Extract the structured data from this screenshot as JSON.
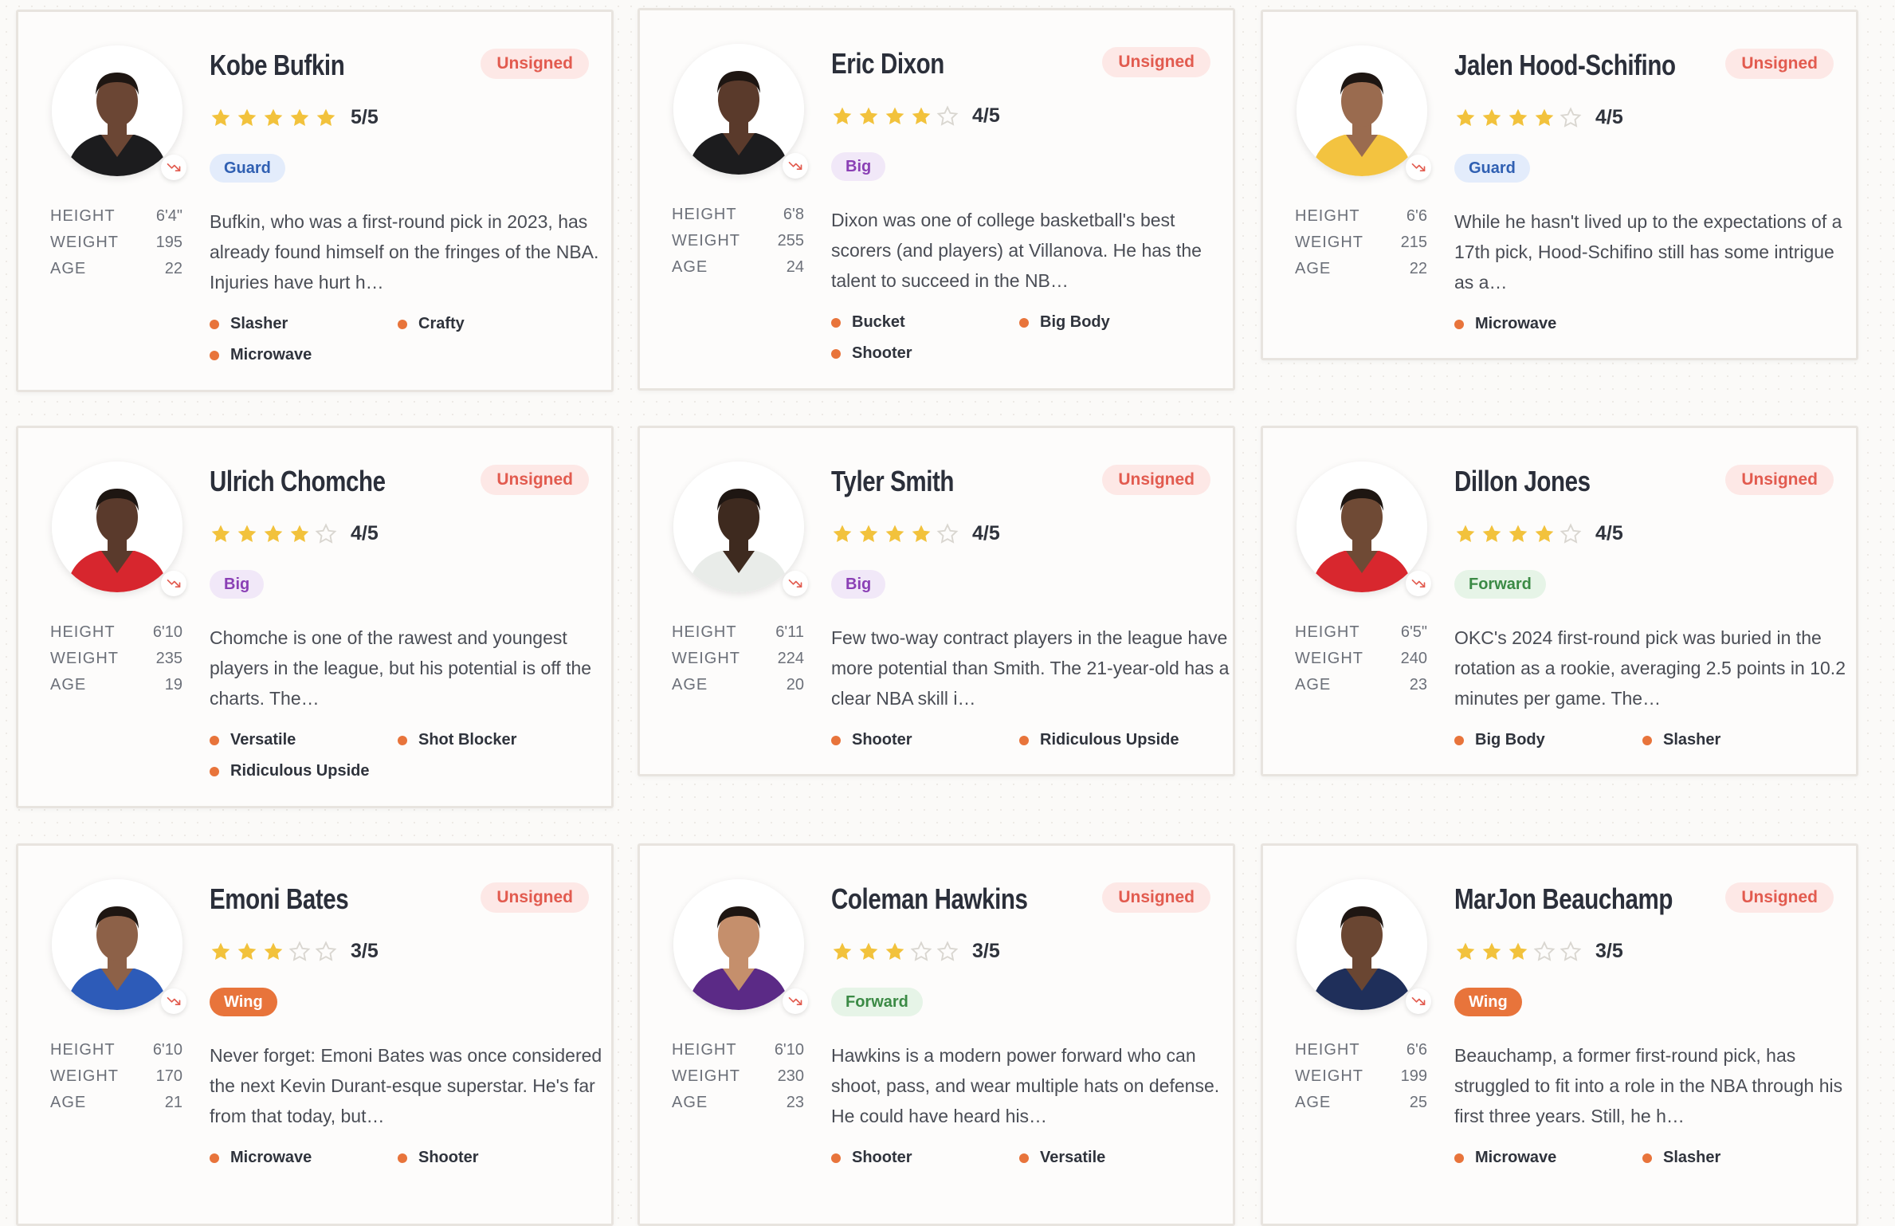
{
  "colors": {
    "star_filled": "#f2c23c",
    "star_empty": "#d9d6d0",
    "unsigned_bg": "#fde8e6",
    "unsigned_text": "#e25b4f",
    "trait_dot": "#e8743b",
    "trend_arrow": "#e25b4f"
  },
  "stat_labels": {
    "height": "HEIGHT",
    "weight": "WEIGHT",
    "age": "AGE"
  },
  "players": [
    {
      "name": "Kobe Bufkin",
      "status": "Unsigned",
      "rating": 5,
      "rating_text": "5/5",
      "position": "Guard",
      "height": "6'4\"",
      "weight": "195",
      "age": "22",
      "description": "Bufkin, who was a first-round pick in 2023, has already found himself on the fringes of the NBA. Injuries have hurt h…",
      "traits": [
        "Slasher",
        "Crafty",
        "Microwave"
      ],
      "trend_icon": "trending-down-icon"
    },
    {
      "name": "Eric Dixon",
      "status": "Unsigned",
      "rating": 4,
      "rating_text": "4/5",
      "position": "Big",
      "height": "6'8",
      "weight": "255",
      "age": "24",
      "description": "Dixon was one of college basketball's best scorers (and players) at Villanova. He has the talent to succeed in the NB…",
      "traits": [
        "Bucket",
        "Big Body",
        "Shooter"
      ],
      "trend_icon": "trending-down-icon"
    },
    {
      "name": "Jalen Hood-Schifino",
      "status": "Unsigned",
      "rating": 4,
      "rating_text": "4/5",
      "position": "Guard",
      "height": "6'6",
      "weight": "215",
      "age": "22",
      "description": "While he hasn't lived up to the expectations of a 17th pick, Hood-Schifino still has some intrigue as a…",
      "traits": [
        "Microwave"
      ],
      "trend_icon": "trending-down-icon"
    },
    {
      "name": "Ulrich Chomche",
      "status": "Unsigned",
      "rating": 4,
      "rating_text": "4/5",
      "position": "Big",
      "height": "6'10",
      "weight": "235",
      "age": "19",
      "description": "Chomche is one of the rawest and youngest players in the league, but his potential is off the charts. The…",
      "traits": [
        "Versatile",
        "Shot Blocker",
        "Ridiculous Upside"
      ],
      "trend_icon": "trending-down-icon"
    },
    {
      "name": "Tyler Smith",
      "status": "Unsigned",
      "rating": 4,
      "rating_text": "4/5",
      "position": "Big",
      "height": "6'11",
      "weight": "224",
      "age": "20",
      "description": "Few two-way contract players in the league have more potential than Smith. The 21-year-old has a clear NBA skill i…",
      "traits": [
        "Shooter",
        "Ridiculous Upside"
      ],
      "trend_icon": "trending-down-icon"
    },
    {
      "name": "Dillon Jones",
      "status": "Unsigned",
      "rating": 4,
      "rating_text": "4/5",
      "position": "Forward",
      "height": "6'5\"",
      "weight": "240",
      "age": "23",
      "description": "OKC's 2024 first-round pick was buried in the rotation as a rookie, averaging 2.5 points in 10.2 minutes per game. The…",
      "traits": [
        "Big Body",
        "Slasher"
      ],
      "trend_icon": "trending-down-icon"
    },
    {
      "name": "Emoni Bates",
      "status": "Unsigned",
      "rating": 3,
      "rating_text": "3/5",
      "position": "Wing",
      "height": "6'10",
      "weight": "170",
      "age": "21",
      "description": "Never forget: Emoni Bates was once considered the next Kevin Durant-esque superstar. He's far from that today, but…",
      "traits": [
        "Microwave",
        "Shooter"
      ],
      "trend_icon": "trending-down-icon"
    },
    {
      "name": "Coleman Hawkins",
      "status": "Unsigned",
      "rating": 3,
      "rating_text": "3/5",
      "position": "Forward",
      "height": "6'10",
      "weight": "230",
      "age": "23",
      "description": "Hawkins is a modern power forward who can shoot, pass, and wear multiple hats on defense. He could have heard his…",
      "traits": [
        "Shooter",
        "Versatile"
      ],
      "trend_icon": "trending-down-icon"
    },
    {
      "name": "MarJon Beauchamp",
      "status": "Unsigned",
      "rating": 3,
      "rating_text": "3/5",
      "position": "Wing",
      "height": "6'6",
      "weight": "199",
      "age": "25",
      "description": "Beauchamp, a former first-round pick, has struggled to fit into a role in the NBA through his first three years. Still, he h…",
      "traits": [
        "Microwave",
        "Slasher"
      ],
      "trend_icon": "trending-down-icon"
    }
  ]
}
